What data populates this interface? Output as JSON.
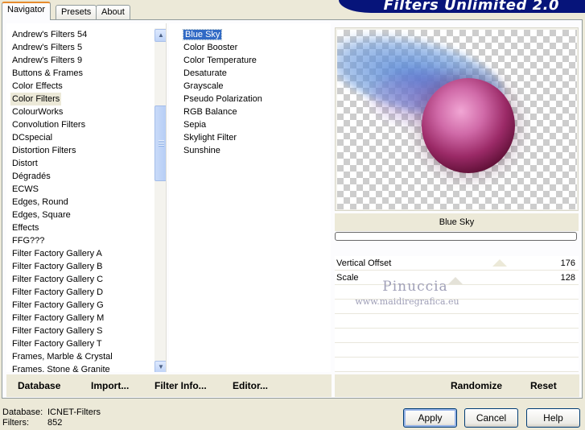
{
  "tabs": [
    {
      "label": "Navigator",
      "active": true
    },
    {
      "label": "Presets",
      "active": false
    },
    {
      "label": "About",
      "active": false
    }
  ],
  "banner_title": "Filters Unlimited 2.0",
  "categories": {
    "items": [
      "Andrew's Filters 54",
      "Andrew's Filters 5",
      "Andrew's Filters 9",
      "Buttons & Frames",
      "Color Effects",
      "Color Filters",
      "ColourWorks",
      "Convolution Filters",
      "DCspecial",
      "Distortion Filters",
      "Distort",
      "Dégradés",
      "ECWS",
      "Edges, Round",
      "Edges, Square",
      "Effects",
      "FFG???",
      "Filter Factory Gallery A",
      "Filter Factory Gallery B",
      "Filter Factory Gallery C",
      "Filter Factory Gallery D",
      "Filter Factory Gallery G",
      "Filter Factory Gallery M",
      "Filter Factory Gallery S",
      "Filter Factory Gallery T",
      "Frames, Marble & Crystal",
      "Frames, Stone & Granite"
    ],
    "selected": "Color Filters"
  },
  "filters": {
    "items": [
      "Blue Sky",
      "Color Booster",
      "Color Temperature",
      "Desaturate",
      "Grayscale",
      "Pseudo Polarization",
      "RGB Balance",
      "Sepia",
      "Skylight Filter",
      "Sunshine"
    ],
    "selected": "Blue Sky"
  },
  "preview": {
    "filter_name": "Blue Sky",
    "progress": 0
  },
  "params": [
    {
      "label": "Vertical Offset",
      "value": "176"
    },
    {
      "label": "Scale",
      "value": "128"
    }
  ],
  "watermark": {
    "line1": "Pinuccia",
    "line2": "www.maidiregrafica.eu"
  },
  "left_actions": {
    "database": "Database",
    "import": "Import...",
    "filter_info": "Filter Info...",
    "editor": "Editor..."
  },
  "right_actions": {
    "randomize": "Randomize",
    "reset": "Reset"
  },
  "footer": {
    "database_key": "Database:",
    "database_value": "ICNET-Filters",
    "filters_key": "Filters:",
    "filters_value": "852"
  },
  "buttons": {
    "apply": "Apply",
    "cancel": "Cancel",
    "help": "Help"
  }
}
